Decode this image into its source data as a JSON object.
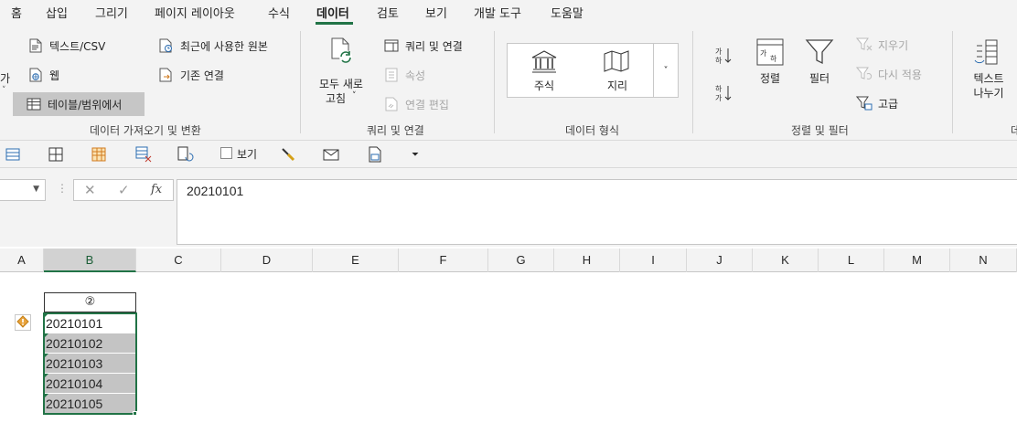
{
  "tabs": [
    "홈",
    "삽입",
    "그리기",
    "페이지 레이아웃",
    "수식",
    "데이터",
    "검토",
    "보기",
    "개발 도구",
    "도움말"
  ],
  "ribbon": {
    "get_transform": {
      "partial_label": "가",
      "text_csv": "텍스트/CSV",
      "web": "웹",
      "table_range": "테이블/범위에서",
      "recent_sources": "최근에 사용한 원본",
      "existing_connections": "기존 연결",
      "group_label": "데이터 가져오기 및 변환"
    },
    "queries": {
      "refresh_all_line1": "모두 새로",
      "refresh_all_line2": "고침",
      "queries_connections": "쿼리 및 연결",
      "properties": "속성",
      "edit_links": "연결 편집",
      "group_label": "쿼리 및 연결"
    },
    "data_types": {
      "stocks": "주식",
      "geography": "지리",
      "group_label": "데이터 형식"
    },
    "sort_filter": {
      "sort": "정렬",
      "filter": "필터",
      "clear": "지우기",
      "reapply": "다시 적용",
      "advanced": "고급",
      "group_label": "정렬 및 필터"
    },
    "data_tools": {
      "text_to_columns_line1": "텍스트",
      "text_to_columns_line2": "나누기",
      "partial_label": "데"
    }
  },
  "qat": {
    "view_checkbox_label": "보기"
  },
  "formula_bar": {
    "fx_label": "fx",
    "formula_value": "20210101"
  },
  "columns": [
    "A",
    "B",
    "C",
    "D",
    "E",
    "F",
    "G",
    "H",
    "I",
    "J",
    "K",
    "L",
    "M",
    "N"
  ],
  "selected_column": "B",
  "sheet": {
    "header_cell": "②",
    "values": [
      "20210101",
      "20210102",
      "20210103",
      "20210104",
      "20210105"
    ]
  },
  "colors": {
    "accent": "#217346",
    "selection_fill": "#c4c4c4",
    "warning": "#e8a33c"
  }
}
